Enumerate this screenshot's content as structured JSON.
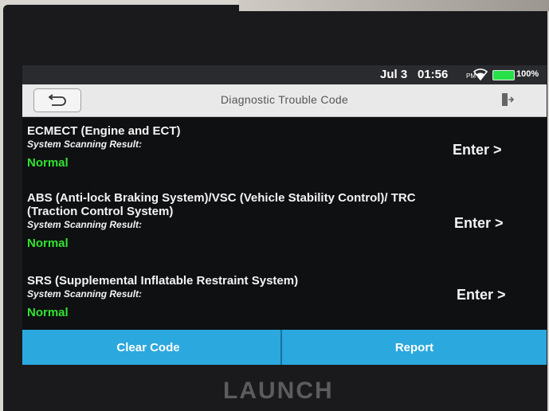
{
  "status_bar": {
    "date": "Jul 3",
    "time": "01:56",
    "ampm": "PM",
    "battery": "100%"
  },
  "title_bar": {
    "title": "Diagnostic Trouble Code"
  },
  "systems": [
    {
      "name": "ECMECT (Engine and ECT)",
      "result_label": "System Scanning Result:",
      "status": "Normal",
      "enter_label": "Enter >"
    },
    {
      "name": "ABS (Anti-lock Braking System)/VSC (Vehicle Stability Control)/ TRC (Traction Control System)",
      "result_label": "System Scanning Result:",
      "status": "Normal",
      "enter_label": "Enter >"
    },
    {
      "name": "SRS (Supplemental Inflatable Restraint System)",
      "result_label": "System Scanning Result:",
      "status": "Normal",
      "enter_label": "Enter >"
    }
  ],
  "actions": {
    "clear_code": "Clear Code",
    "report": "Report"
  },
  "brand": "LAUNCH",
  "colors": {
    "status_normal": "#31e331",
    "action_bar": "#2ba8de"
  }
}
